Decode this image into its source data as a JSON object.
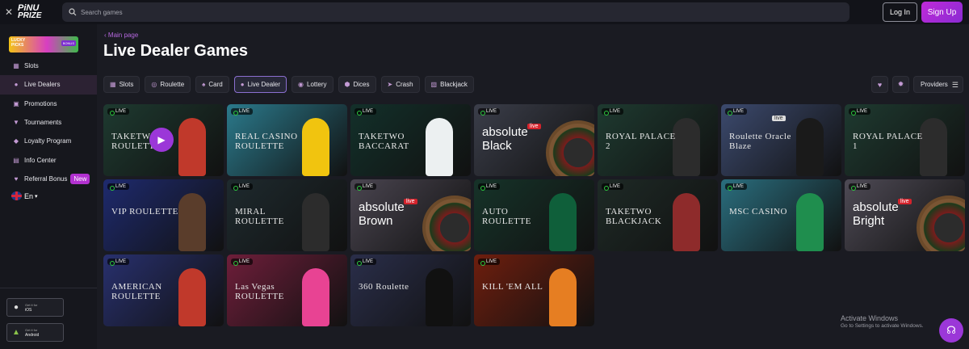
{
  "header": {
    "logo_line1": "PiNU",
    "logo_line2": "PRIZE",
    "search_placeholder": "Search games",
    "login_label": "Log In",
    "signup_label": "Sign Up"
  },
  "sidebar": {
    "promo": {
      "line1": "LUCKY",
      "line2": "PICKS",
      "badge": "BONUS"
    },
    "items": [
      {
        "label": "Slots",
        "icon": "slots-icon"
      },
      {
        "label": "Live Dealers",
        "icon": "person-icon",
        "active": true
      },
      {
        "label": "Promotions",
        "icon": "gift-icon"
      },
      {
        "label": "Tournaments",
        "icon": "trophy-icon"
      },
      {
        "label": "Loyalty Program",
        "icon": "loyalty-icon"
      },
      {
        "label": "Info Center",
        "icon": "info-icon"
      },
      {
        "label": "Referral Bonus",
        "icon": "referral-icon",
        "badge": "New"
      }
    ],
    "language": "En",
    "store_small": "Get it for",
    "ios_label": "iOS",
    "android_label": "Android"
  },
  "main": {
    "breadcrumb": "Main page",
    "title": "Live Dealer Games",
    "filters": [
      {
        "label": "Slots",
        "icon": "slots-icon"
      },
      {
        "label": "Roulette",
        "icon": "roulette-icon"
      },
      {
        "label": "Card",
        "icon": "card-icon"
      },
      {
        "label": "Live Dealer",
        "icon": "person-icon",
        "active": true
      },
      {
        "label": "Lottery",
        "icon": "lottery-icon"
      },
      {
        "label": "Dices",
        "icon": "dice-icon"
      },
      {
        "label": "Crash",
        "icon": "crash-icon"
      },
      {
        "label": "Blackjack",
        "icon": "blackjack-icon"
      }
    ],
    "providers_label": "Providers",
    "live_label": "LIVE",
    "live_badge": "live",
    "games": [
      {
        "title": "TAKETWO ROULETTE",
        "bg": "#1e3a30",
        "accent": "#c0392b"
      },
      {
        "title": "REAL CASINO ROULETTE",
        "bg": "#2b7a8c",
        "accent": "#f1c40f"
      },
      {
        "title": "TAKETWO BACCARAT",
        "bg": "#13302a",
        "accent": "#ecf0f1"
      },
      {
        "title": "absolute Black",
        "bg": "#3b3e4a",
        "accent": "#7f8c8d"
      },
      {
        "title": "ROYAL PALACE 2",
        "bg": "#1e3a30",
        "accent": "#2c2c2c"
      },
      {
        "title": "Roulette Oracle Blaze",
        "bg": "#3c4a6e",
        "accent": "#1a1a1a"
      },
      {
        "title": "ROYAL PALACE 1",
        "bg": "#1e3a30",
        "accent": "#2c2c2c"
      },
      {
        "title": "VIP ROULETTE",
        "bg": "#1e2a6e",
        "accent": "#5a3d2b"
      },
      {
        "title": "MIRAL ROULETTE",
        "bg": "#1e2a2e",
        "accent": "#2c2c2c"
      },
      {
        "title": "absolute Brown",
        "bg": "#4a4550",
        "accent": "#6a4a3a"
      },
      {
        "title": "AUTO ROULETTE",
        "bg": "#163329",
        "accent": "#0f5f3a"
      },
      {
        "title": "TAKETWO BLACKJACK",
        "bg": "#1e2a26",
        "accent": "#8e2b2b"
      },
      {
        "title": "MSC CASINO",
        "bg": "#2a6e7e",
        "accent": "#1f8e4e"
      },
      {
        "title": "absolute Bright",
        "bg": "#4e4a55",
        "accent": "#9a7060"
      },
      {
        "title": "AMERICAN ROULETTE",
        "bg": "#28306e",
        "accent": "#c0392b"
      },
      {
        "title": "Las Vegas ROULETTE",
        "bg": "#6e1e3a",
        "accent": "#e84393"
      },
      {
        "title": "360 Roulette",
        "bg": "#2a2e4a",
        "accent": "#111"
      },
      {
        "title": "KILL 'EM ALL",
        "bg": "#6e1e0e",
        "accent": "#e67e22"
      }
    ]
  },
  "watermark": {
    "line1": "Activate Windows",
    "line2": "Go to Settings to activate Windows."
  }
}
